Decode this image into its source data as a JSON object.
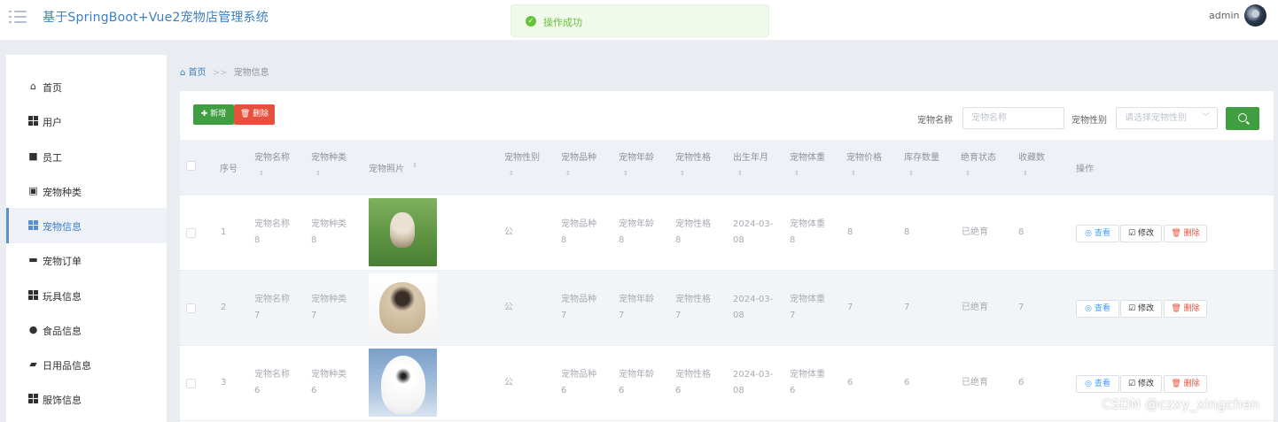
{
  "header": {
    "title": "基于SpringBoot+Vue2宠物店管理系统",
    "toast": "操作成功",
    "user": "admin"
  },
  "sidebar": {
    "items": [
      {
        "label": "首页",
        "icon": "home-icon"
      },
      {
        "label": "用户",
        "icon": "grid-icon"
      },
      {
        "label": "员工",
        "icon": "briefcase-icon"
      },
      {
        "label": "宠物种类",
        "icon": "clipboard-icon"
      },
      {
        "label": "宠物信息",
        "icon": "grid-icon",
        "active": true
      },
      {
        "label": "宠物订单",
        "icon": "monitor-icon"
      },
      {
        "label": "玩具信息",
        "icon": "grid-icon"
      },
      {
        "label": "食品信息",
        "icon": "user-icon"
      },
      {
        "label": "日用品信息",
        "icon": "wallet-icon"
      },
      {
        "label": "服饰信息",
        "icon": "grid-icon"
      }
    ]
  },
  "breadcrumb": {
    "home": "首页",
    "separator": ">>",
    "current": "宠物信息"
  },
  "toolbar": {
    "add_label": "新增",
    "delete_label": "删除",
    "name_filter_label": "宠物名称",
    "name_filter_placeholder": "宠物名称",
    "gender_filter_label": "宠物性别",
    "gender_filter_placeholder": "请选择宠物性别"
  },
  "table": {
    "columns": [
      "序号",
      "宠物名称",
      "宠物种类",
      "宠物照片",
      "宠物性别",
      "宠物品种",
      "宠物年龄",
      "宠物性格",
      "出生年月",
      "宠物体重",
      "宠物价格",
      "库存数量",
      "绝育状态",
      "收藏数",
      "操作"
    ],
    "rows": [
      {
        "index": "1",
        "name": [
          "宠物名称",
          "8"
        ],
        "type": [
          "宠物种类",
          "8"
        ],
        "gender": "公",
        "breed": [
          "宠物品种",
          "8"
        ],
        "age": [
          "宠物年龄",
          "8"
        ],
        "temper": [
          "宠物性格",
          "8"
        ],
        "birth": [
          "2024-03-",
          "08"
        ],
        "weight": [
          "宠物体重",
          "8"
        ],
        "price": "8",
        "stock": "8",
        "sterilized": "已绝育",
        "favorites": "8"
      },
      {
        "index": "2",
        "name": [
          "宠物名称",
          "7"
        ],
        "type": [
          "宠物种类",
          "7"
        ],
        "gender": "公",
        "breed": [
          "宠物品种",
          "7"
        ],
        "age": [
          "宠物年龄",
          "7"
        ],
        "temper": [
          "宠物性格",
          "7"
        ],
        "birth": [
          "2024-03-",
          "08"
        ],
        "weight": [
          "宠物体重",
          "7"
        ],
        "price": "7",
        "stock": "7",
        "sterilized": "已绝育",
        "favorites": "7"
      },
      {
        "index": "3",
        "name": [
          "宠物名称",
          "6"
        ],
        "type": [
          "宠物种类",
          "6"
        ],
        "gender": "公",
        "breed": [
          "宠物品种",
          "6"
        ],
        "age": [
          "宠物年龄",
          "6"
        ],
        "temper": [
          "宠物性格",
          "6"
        ],
        "birth": [
          "2024-03-",
          "08"
        ],
        "weight": [
          "宠物体重",
          "6"
        ],
        "price": "6",
        "stock": "6",
        "sterilized": "已绝育",
        "favorites": "6"
      }
    ],
    "actions": {
      "view": "查看",
      "edit": "修改",
      "delete": "删除"
    }
  },
  "watermark": "CSDN @czxy_xingchen",
  "colors": {
    "accent": "#3c7fc4",
    "add": "#3f9f40",
    "danger": "#e6513e",
    "success": "#67c23a"
  }
}
